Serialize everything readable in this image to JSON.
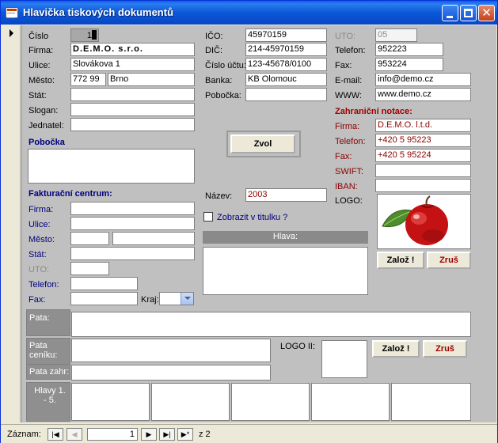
{
  "window": {
    "title": "Hlavička tiskových dokumentů"
  },
  "left": {
    "cislo_label": "Číslo",
    "cislo_value": "1",
    "firma_label": "Firma:",
    "firma_value": "D.E.M.O. s.r.o.",
    "ulice_label": "Ulice:",
    "ulice_value": "Slovákova 1",
    "mesto_label": "Město:",
    "psc_value": "772 99",
    "mesto_value": "Brno",
    "stat_label": "Stát:",
    "slogan_label": "Slogan:",
    "jednatel_label": "Jednatel:",
    "pobocka_header": "Pobočka"
  },
  "middle": {
    "ico_label": "IČO:",
    "ico_value": "45970159",
    "dic_label": "DIČ:",
    "dic_value": "214-45970159",
    "ucet_label": "Číslo účtu:",
    "ucet_value": "123-45678/0100",
    "banka_label": "Banka:",
    "banka_value": "KB Olomouc",
    "pobocka_label": "Pobočka:",
    "zvol_label": "Zvol",
    "nazev_label": "Název:",
    "nazev_value": "2003",
    "zobrazit_label": "Zobrazit v titulku ?",
    "hlava_label": "Hlava:"
  },
  "right": {
    "uto_label": "UTO:",
    "uto_value": "05",
    "telefon_label": "Telefon:",
    "telefon_value": "952223",
    "fax_label": "Fax:",
    "fax_value": "953224",
    "email_label": "E-mail:",
    "email_value": "info@demo.cz",
    "www_label": "WWW:",
    "www_value": "www.demo.cz",
    "zahranicni_header": "Zahraniční notace:",
    "zfirma_label": "Firma:",
    "zfirma_value": "D.E.M.O. l.t.d.",
    "ztelefon_label": "Telefon:",
    "ztelefon_value": "+420 5 95223",
    "zfax_label": "Fax:",
    "zfax_value": "+420 5 95224",
    "swift_label": "SWIFT:",
    "iban_label": "IBAN:",
    "logo_label": "LOGO:",
    "zaloz_label": "Založ !",
    "zrus_label": "Zruš"
  },
  "fakturacni": {
    "header": "Fakturační centrum:",
    "firma_label": "Firma:",
    "ulice_label": "Ulice:",
    "mesto_label": "Město:",
    "stat_label": "Stát:",
    "uto_label": "UTO:",
    "telefon_label": "Telefon:",
    "fax_label": "Fax:",
    "kraj_label": "Kraj:"
  },
  "bottom": {
    "pata_label": "Pata:",
    "pata_ceniku_label": "Pata ceníku:",
    "logo2_label": "LOGO II:",
    "zaloz2_label": "Založ !",
    "zrus2_label": "Zruš",
    "pata_zahr_label": "Pata zahr:",
    "hlavy_label": "Hlavy 1. - 5."
  },
  "navigation": {
    "label": "Záznam:",
    "current": "1",
    "of_text": "z  2"
  }
}
